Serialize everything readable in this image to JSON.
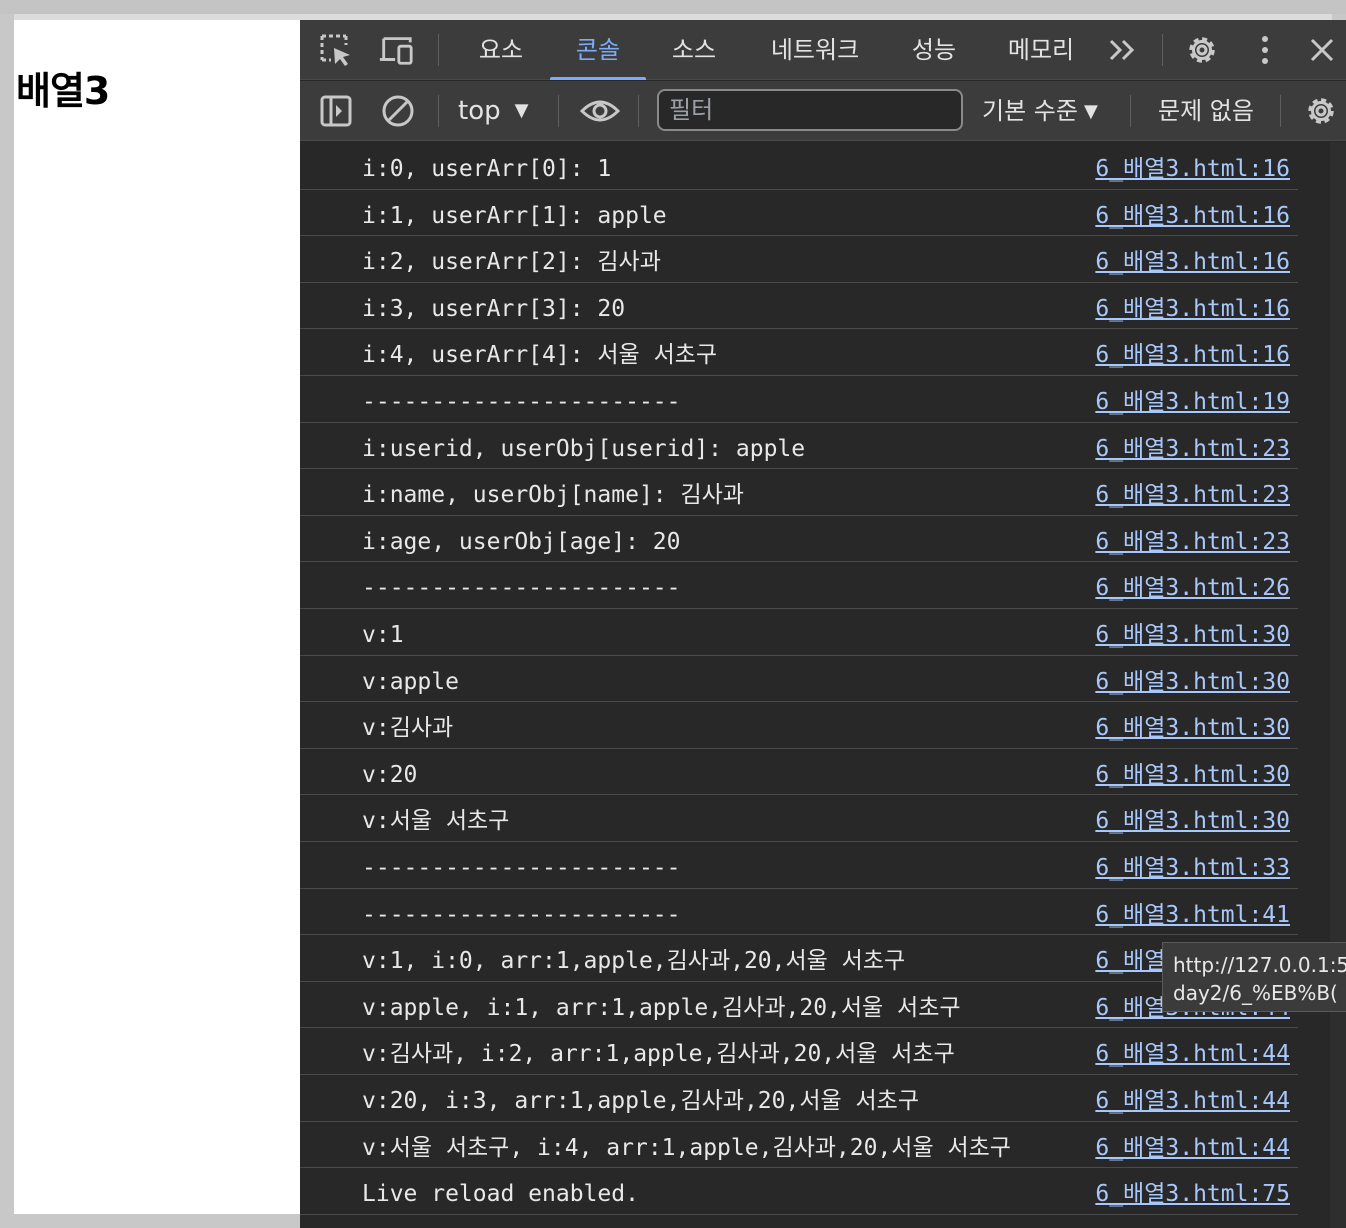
{
  "page": {
    "heading": "배열3"
  },
  "devtools": {
    "tabs": [
      {
        "label": "요소"
      },
      {
        "label": "콘솔"
      },
      {
        "label": "소스"
      },
      {
        "label": "네트워크"
      },
      {
        "label": "성능"
      },
      {
        "label": "메모리"
      }
    ],
    "active_tab": "콘솔",
    "icons": {
      "inspect": "inspect-element-icon",
      "device": "device-toolbar-icon",
      "more_tabs": "more-tabs-icon",
      "settings": "gear-icon",
      "kebab": "kebab-menu-icon",
      "close": "close-icon"
    }
  },
  "toolbar": {
    "context": "top",
    "filter_placeholder": "필터",
    "levels": "기본 수준",
    "issues": "문제 없음"
  },
  "console": {
    "rows": [
      {
        "msg": "i:0, userArr[0]: 1",
        "src": "6_배열3.html:16"
      },
      {
        "msg": "i:1, userArr[1]: apple",
        "src": "6_배열3.html:16"
      },
      {
        "msg": "i:2, userArr[2]: 김사과",
        "src": "6_배열3.html:16"
      },
      {
        "msg": "i:3, userArr[3]: 20",
        "src": "6_배열3.html:16"
      },
      {
        "msg": "i:4, userArr[4]: 서울 서초구",
        "src": "6_배열3.html:16"
      },
      {
        "msg": "-----------------------",
        "src": "6_배열3.html:19"
      },
      {
        "msg": "i:userid, userObj[userid]: apple",
        "src": "6_배열3.html:23"
      },
      {
        "msg": "i:name, userObj[name]: 김사과",
        "src": "6_배열3.html:23"
      },
      {
        "msg": "i:age, userObj[age]: 20",
        "src": "6_배열3.html:23"
      },
      {
        "msg": "-----------------------",
        "src": "6_배열3.html:26"
      },
      {
        "msg": "v:1",
        "src": "6_배열3.html:30"
      },
      {
        "msg": "v:apple",
        "src": "6_배열3.html:30"
      },
      {
        "msg": "v:김사과",
        "src": "6_배열3.html:30"
      },
      {
        "msg": "v:20",
        "src": "6_배열3.html:30"
      },
      {
        "msg": "v:서울 서초구",
        "src": "6_배열3.html:30"
      },
      {
        "msg": "-----------------------",
        "src": "6_배열3.html:33"
      },
      {
        "msg": "-----------------------",
        "src": "6_배열3.html:41"
      },
      {
        "msg": "v:1, i:0, arr:1,apple,김사과,20,서울 서초구",
        "src": "6_배열3.html:44"
      },
      {
        "msg": "v:apple, i:1, arr:1,apple,김사과,20,서울 서초구",
        "src": "6_배열3.html:44"
      },
      {
        "msg": "v:김사과, i:2, arr:1,apple,김사과,20,서울 서초구",
        "src": "6_배열3.html:44"
      },
      {
        "msg": "v:20, i:3, arr:1,apple,김사과,20,서울 서초구",
        "src": "6_배열3.html:44"
      },
      {
        "msg": "v:서울 서초구, i:4, arr:1,apple,김사과,20,서울 서초구",
        "src": "6_배열3.html:44"
      },
      {
        "msg": "Live reload enabled.",
        "src": "6_배열3.html:75"
      }
    ]
  },
  "tooltip": {
    "line1": "http://127.0.0.1:5",
    "line2": "day2/6_%EB%B("
  },
  "colors": {
    "link": "#a8c7fa",
    "active_tab": "#7cacf8",
    "panel_bg": "#282828",
    "toolbar_bg": "#3c3c3c"
  }
}
